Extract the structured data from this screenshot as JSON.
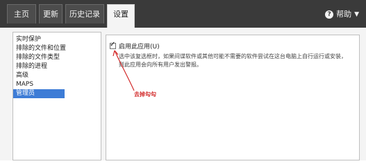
{
  "tabs": [
    {
      "label": "主页"
    },
    {
      "label": "更新"
    },
    {
      "label": "历史记录"
    },
    {
      "label": "设置",
      "active": true
    }
  ],
  "help": {
    "label": "帮助"
  },
  "sidebar": {
    "items": [
      {
        "label": "实时保护"
      },
      {
        "label": "排除的文件和位置"
      },
      {
        "label": "排除的文件类型"
      },
      {
        "label": "排除的进程"
      },
      {
        "label": "高级"
      },
      {
        "label": "MAPS"
      },
      {
        "label": "管理员",
        "selected": true
      }
    ]
  },
  "main": {
    "checkbox_label": "启用此应用(U)",
    "checkbox_checked": true,
    "description": "选中该复选框时，如果间谍软件或其他可能不需要的软件尝试在这台电脑上自行运行或安装，则此应用会向所有用户发出警报。",
    "annotation": "去掉勾勾",
    "annotation_color": "#d22a2a"
  },
  "colors": {
    "topbar": "#3a3a3a",
    "selected": "#3d7cd6"
  }
}
